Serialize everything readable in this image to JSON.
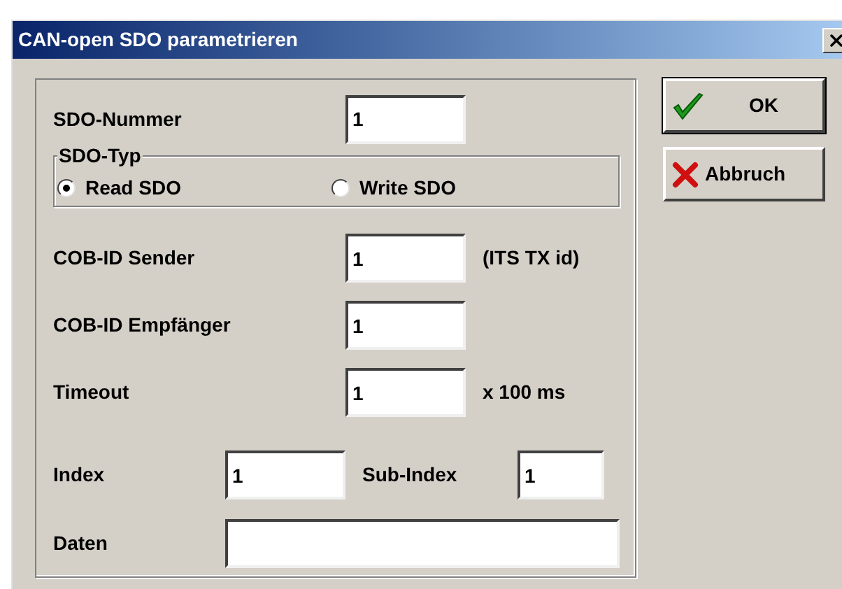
{
  "window": {
    "title": "CAN-open SDO parametrieren"
  },
  "sdo_number": {
    "label": "SDO-Nummer",
    "value": "1"
  },
  "sdo_type": {
    "label": "SDO-Typ",
    "options": [
      {
        "label": "Read SDO",
        "selected": true
      },
      {
        "label": "Write SDO",
        "selected": false
      }
    ]
  },
  "fields": [
    {
      "label": "COB-ID Sender",
      "value": "1",
      "unit": "(ITS TX id)"
    },
    {
      "label": "COB-ID Empfänger",
      "value": "1"
    },
    {
      "label": "Timeout",
      "value": "1",
      "unit": "x 100 ms"
    }
  ],
  "index": {
    "label": "Index",
    "value": "1"
  },
  "sub_index": {
    "label": "Sub-Index",
    "value": "1"
  },
  "data": {
    "label": "Daten"
  },
  "buttons": [
    {
      "kind": "ok",
      "label": "OK",
      "default": true
    },
    {
      "kind": "cancel",
      "label": "Abbruch",
      "default": false
    }
  ]
}
